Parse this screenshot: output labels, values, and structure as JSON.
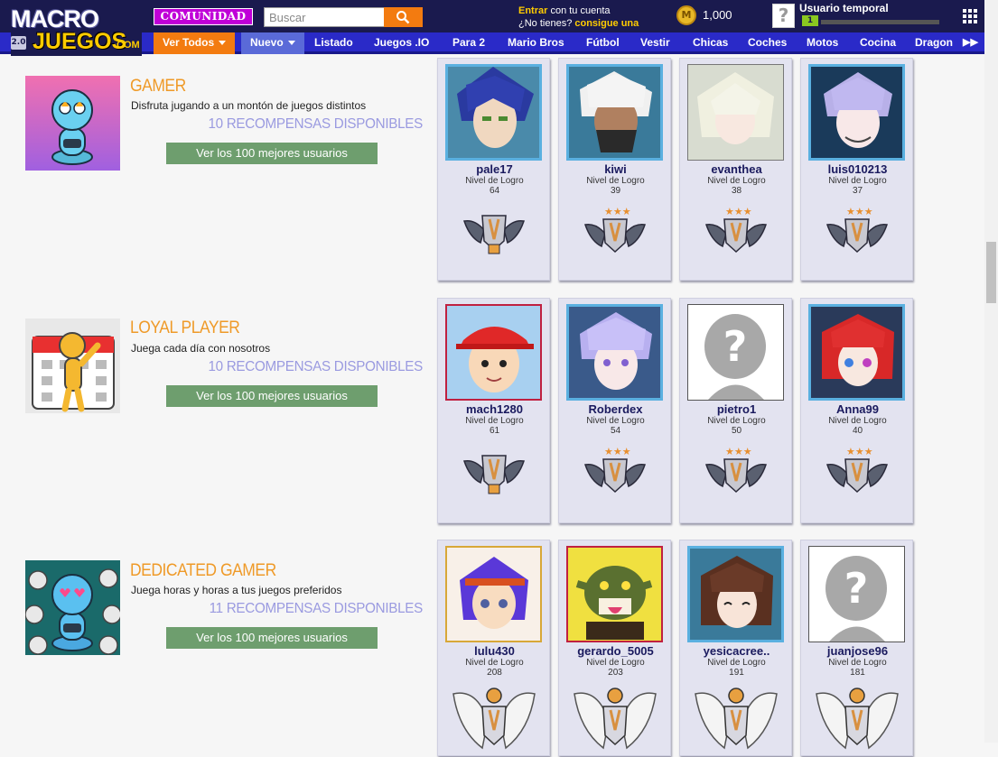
{
  "header": {
    "logo_top": "MACRO",
    "logo_bottom": "JUEGOS",
    "logo_suffix": ".COM",
    "version_badge": "2.0",
    "comunidad_label": "COMUNIDAD",
    "search_placeholder": "Buscar",
    "login_enter": "Entrar",
    "login_rest": " con tu cuenta",
    "login_q": "¿No tienes? ",
    "login_signup": "consigue una",
    "coin_symbol": "M",
    "coins": "1,000",
    "user_avatar": "?",
    "user_name": "Usuario temporal",
    "user_level": "1"
  },
  "nav": {
    "items": [
      "Ver Todos",
      "Nuevo",
      "Listado",
      "Juegos .IO",
      "Para 2",
      "Mario Bros",
      "Fútbol",
      "Vestir",
      "Chicas",
      "Coches",
      "Motos",
      "Cocina",
      "Dragon"
    ],
    "more": "▶▶"
  },
  "achievements": [
    {
      "title": "GAMER",
      "description": "Disfruta jugando a un montón de juegos distintos",
      "rewards": "10 RECOMPENSAS DISPONIBLES",
      "button": "Ver los 100 mejores usuarios",
      "users": [
        {
          "name": "pale17",
          "level_label": "Nivel de Logro",
          "level": "64"
        },
        {
          "name": "kiwi",
          "level_label": "Nivel de Logro",
          "level": "39"
        },
        {
          "name": "evanthea",
          "level_label": "Nivel de Logro",
          "level": "38"
        },
        {
          "name": "luis010213",
          "level_label": "Nivel de Logro",
          "level": "37"
        }
      ]
    },
    {
      "title": "LOYAL PLAYER",
      "description": "Juega cada día con nosotros",
      "rewards": "10 RECOMPENSAS DISPONIBLES",
      "button": "Ver los 100 mejores usuarios",
      "users": [
        {
          "name": "mach1280",
          "level_label": "Nivel de Logro",
          "level": "61"
        },
        {
          "name": "Roberdex",
          "level_label": "Nivel de Logro",
          "level": "54"
        },
        {
          "name": "pietro1",
          "level_label": "Nivel de Logro",
          "level": "50"
        },
        {
          "name": "Anna99",
          "level_label": "Nivel de Logro",
          "level": "40"
        }
      ]
    },
    {
      "title": "DEDICATED GAMER",
      "description": "Juega horas y horas a tus juegos preferidos",
      "rewards": "11 RECOMPENSAS DISPONIBLES",
      "button": "Ver los 100 mejores usuarios",
      "users": [
        {
          "name": "lulu430",
          "level_label": "Nivel de Logro",
          "level": "208"
        },
        {
          "name": "gerardo_5005",
          "level_label": "Nivel de Logro",
          "level": "203"
        },
        {
          "name": "yesicacree..",
          "level_label": "Nivel de Logro",
          "level": "191"
        },
        {
          "name": "juanjose96",
          "level_label": "Nivel de Logro",
          "level": "181"
        }
      ]
    }
  ],
  "colors": {
    "header_bg": "#1a1a4e",
    "nav_bg": "#2a2ac8",
    "accent_orange": "#f37b10",
    "title_orange": "#ef9a28",
    "rewards_lilac": "#9a9ae0",
    "button_green": "#6e9e6e",
    "card_bg": "#e3e3f0"
  }
}
